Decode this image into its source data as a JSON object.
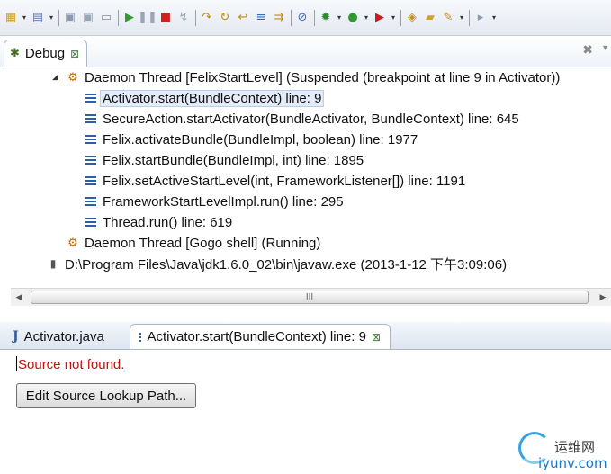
{
  "toolbar": {
    "buttons": [
      {
        "icon": "new-icon",
        "glyph": "▦",
        "color": "#c9a020"
      },
      {
        "icon": "dropdown-icon",
        "glyph": "▾",
        "color": "#333333"
      },
      {
        "icon": "new-wizard-icon",
        "glyph": "▤",
        "color": "#5a7aa8"
      },
      {
        "icon": "dropdown-icon",
        "glyph": "▾",
        "color": "#333333"
      },
      {
        "icon": "separator"
      },
      {
        "icon": "save-icon",
        "glyph": "▣",
        "color": "#8a9ab0"
      },
      {
        "icon": "save-all-icon",
        "glyph": "▣",
        "color": "#9aa6b8"
      },
      {
        "icon": "print-icon",
        "glyph": "▭",
        "color": "#8a8a8a"
      },
      {
        "icon": "separator"
      },
      {
        "icon": "resume-icon",
        "glyph": "▶",
        "color": "#2f9a2f"
      },
      {
        "icon": "suspend-icon",
        "glyph": "❚❚",
        "color": "#9aa6b8"
      },
      {
        "icon": "terminate-icon",
        "glyph": "■",
        "color": "#d02020"
      },
      {
        "icon": "disconnect-icon",
        "glyph": "↯",
        "color": "#9aa6b8"
      },
      {
        "icon": "separator"
      },
      {
        "icon": "step-into-icon",
        "glyph": "↷",
        "color": "#c08a10"
      },
      {
        "icon": "step-over-icon",
        "glyph": "↻",
        "color": "#c08a10"
      },
      {
        "icon": "step-return-icon",
        "glyph": "↩",
        "color": "#c08a10"
      },
      {
        "icon": "drop-to-frame-icon",
        "glyph": "≡",
        "color": "#3a6ac0"
      },
      {
        "icon": "use-step-filters-icon",
        "glyph": "⇉",
        "color": "#c08a10"
      },
      {
        "icon": "separator"
      },
      {
        "icon": "skip-breakpoints-icon",
        "glyph": "⊘",
        "color": "#3a6ac0"
      },
      {
        "icon": "separator"
      },
      {
        "icon": "debug-icon",
        "glyph": "✹",
        "color": "#2f8a2f"
      },
      {
        "icon": "dropdown-icon",
        "glyph": "▾",
        "color": "#333333"
      },
      {
        "icon": "run-icon",
        "glyph": "●",
        "color": "#2f9a2f"
      },
      {
        "icon": "dropdown-icon",
        "glyph": "▾",
        "color": "#333333"
      },
      {
        "icon": "external-tools-icon",
        "glyph": "▶",
        "color": "#c02020"
      },
      {
        "icon": "dropdown-icon",
        "glyph": "▾",
        "color": "#333333"
      },
      {
        "icon": "separator"
      },
      {
        "icon": "open-type-icon",
        "glyph": "◈",
        "color": "#c09020"
      },
      {
        "icon": "open-folder-icon",
        "glyph": "▰",
        "color": "#d0a030"
      },
      {
        "icon": "wand-icon",
        "glyph": "✎",
        "color": "#c09020"
      },
      {
        "icon": "dropdown-icon",
        "glyph": "▾",
        "color": "#333333"
      },
      {
        "icon": "separator"
      },
      {
        "icon": "forward-icon",
        "glyph": "▸",
        "color": "#8a9ab0"
      },
      {
        "icon": "dropdown-icon",
        "glyph": "▾",
        "color": "#333333"
      }
    ]
  },
  "debug_view": {
    "tab_label": "Debug",
    "tab_close": "⊠",
    "tree": [
      {
        "name": "thread-felix-start-level",
        "kind": "thread",
        "expander": "◢",
        "label": "Daemon Thread [FelixStartLevel] (Suspended (breakpoint at line 9 in Activator))"
      },
      {
        "name": "frame-activator-start",
        "kind": "frame",
        "selected": true,
        "label": "Activator.start(BundleContext) line: 9"
      },
      {
        "name": "frame-secure-action",
        "kind": "frame",
        "label": "SecureAction.startActivator(BundleActivator, BundleContext) line: 645"
      },
      {
        "name": "frame-activate-bundle",
        "kind": "frame",
        "label": "Felix.activateBundle(BundleImpl, boolean) line: 1977"
      },
      {
        "name": "frame-start-bundle",
        "kind": "frame",
        "label": "Felix.startBundle(BundleImpl, int) line: 1895"
      },
      {
        "name": "frame-set-active-start-level",
        "kind": "frame",
        "label": "Felix.setActiveStartLevel(int, FrameworkListener[]) line: 1191"
      },
      {
        "name": "frame-framework-start-level-run",
        "kind": "frame",
        "label": "FrameworkStartLevelImpl.run() line: 295"
      },
      {
        "name": "frame-thread-run",
        "kind": "frame",
        "label": "Thread.run() line: 619"
      },
      {
        "name": "thread-gogo-shell",
        "kind": "thread",
        "label": "Daemon Thread [Gogo shell] (Running)"
      },
      {
        "name": "process-javaw",
        "kind": "process",
        "label": "D:\\Program Files\\Java\\jdk1.6.0_02\\bin\\javaw.exe (2013-1-12 下午3:09:06)"
      }
    ],
    "scroll_thumb_grip": "III"
  },
  "editor": {
    "tabs": [
      {
        "name": "editor-tab-activator-java",
        "label": "Activator.java",
        "active": false
      },
      {
        "name": "editor-tab-activator-start",
        "label": "Activator.start(BundleContext) line: 9",
        "active": true,
        "close": "⊠"
      }
    ],
    "message": "Source not found.",
    "button_label": "Edit Source Lookup Path..."
  },
  "watermark": {
    "cn": "运维网",
    "url": "iyunv.com"
  }
}
